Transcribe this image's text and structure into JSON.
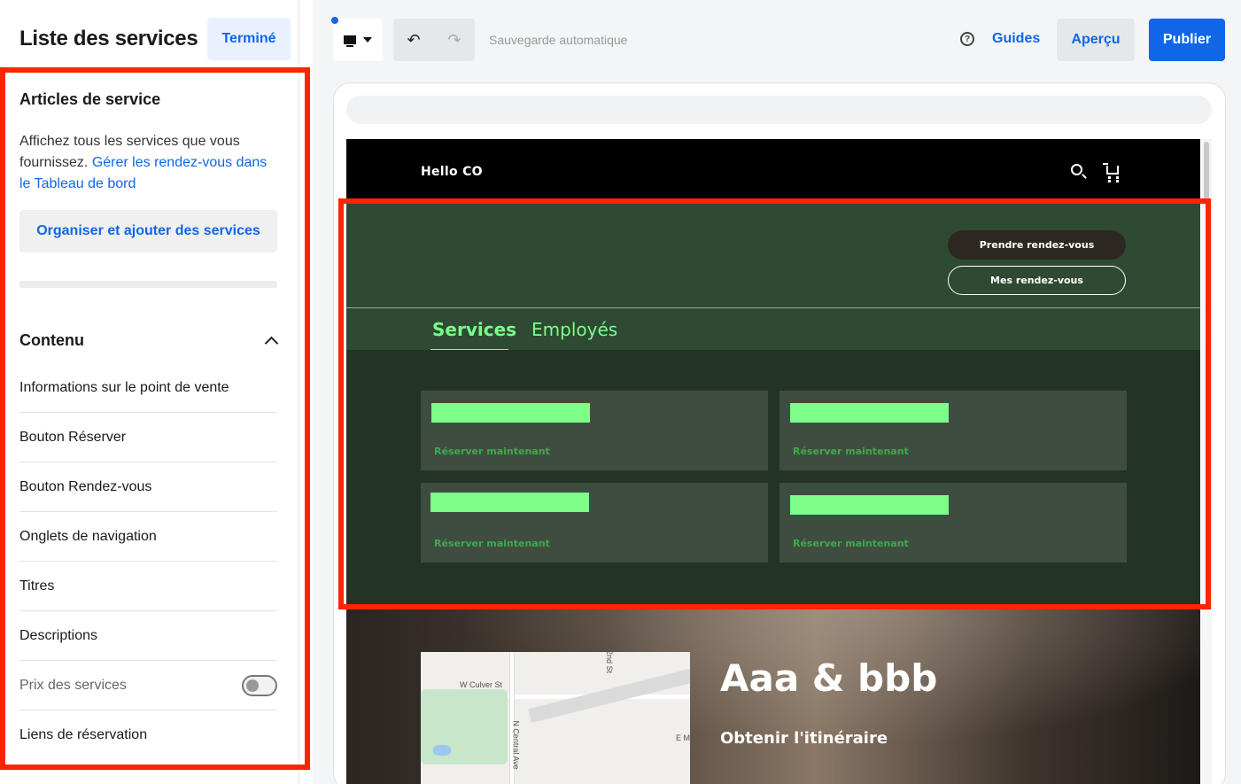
{
  "panel": {
    "title": "Liste des services",
    "done_label": "Terminé",
    "section_title": "Articles de service",
    "description": "Affichez tous les services que vous fournissez.",
    "description_link": "Gérer les rendez-vous dans le Tableau de bord",
    "organize_button": "Organiser et ajouter des services",
    "content_title": "Contenu",
    "items": [
      {
        "label": "Informations sur le point de vente"
      },
      {
        "label": "Bouton Réserver"
      },
      {
        "label": "Bouton Rendez-vous"
      },
      {
        "label": "Onglets de navigation"
      },
      {
        "label": "Titres"
      },
      {
        "label": "Descriptions"
      },
      {
        "label": "Prix des services",
        "toggle": false
      },
      {
        "label": "Liens de réservation"
      }
    ]
  },
  "toolbar": {
    "autosave": "Sauvegarde automatique",
    "guides": "Guides",
    "preview": "Aperçu",
    "publish": "Publier"
  },
  "site": {
    "brand": "Hello CO",
    "book_button": "Prendre rendez-vous",
    "my_appointments_button": "Mes rendez-vous",
    "tabs": [
      "Services",
      "Employés"
    ],
    "cards": [
      {
        "book_link": "Réserver maintenant"
      },
      {
        "book_link": "Réserver maintenant"
      },
      {
        "book_link": "Réserver maintenant"
      },
      {
        "book_link": "Réserver maintenant"
      }
    ],
    "hero_title": "Aaa & bbb",
    "hero_link": "Obtenir l'itinéraire",
    "map_labels": [
      "W Culver St",
      "N Central Ave",
      "2nd St",
      "E M"
    ]
  },
  "colors": {
    "accent": "#1166e8",
    "highlight_frame": "#ff2400",
    "site_green": "#2f4a33",
    "site_green_dark": "#233325",
    "card_name": "#7dff8a"
  }
}
